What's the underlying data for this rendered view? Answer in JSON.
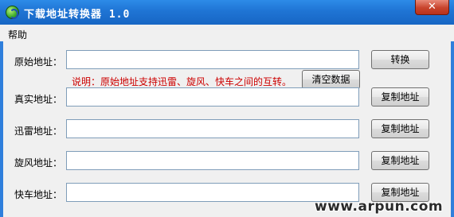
{
  "window": {
    "title": "下载地址转换器 1.0",
    "close_glyph": "✕"
  },
  "menu": {
    "items": [
      "帮助"
    ]
  },
  "fields": [
    {
      "label": "原始地址：",
      "value": ""
    },
    {
      "label": "真实地址：",
      "value": ""
    },
    {
      "label": "迅雷地址：",
      "value": ""
    },
    {
      "label": "旋风地址：",
      "value": ""
    },
    {
      "label": "快车地址：",
      "value": ""
    }
  ],
  "buttons": {
    "convert": "转换",
    "clear": "清空数据",
    "copy": "复制地址"
  },
  "note": "说明：原始地址支持迅雷、旋风、快车之间的互转。",
  "watermark": "www.arpun.com",
  "colors": {
    "titlebar": "#1f74d4",
    "note": "#cc0000",
    "close": "#c8432c"
  }
}
